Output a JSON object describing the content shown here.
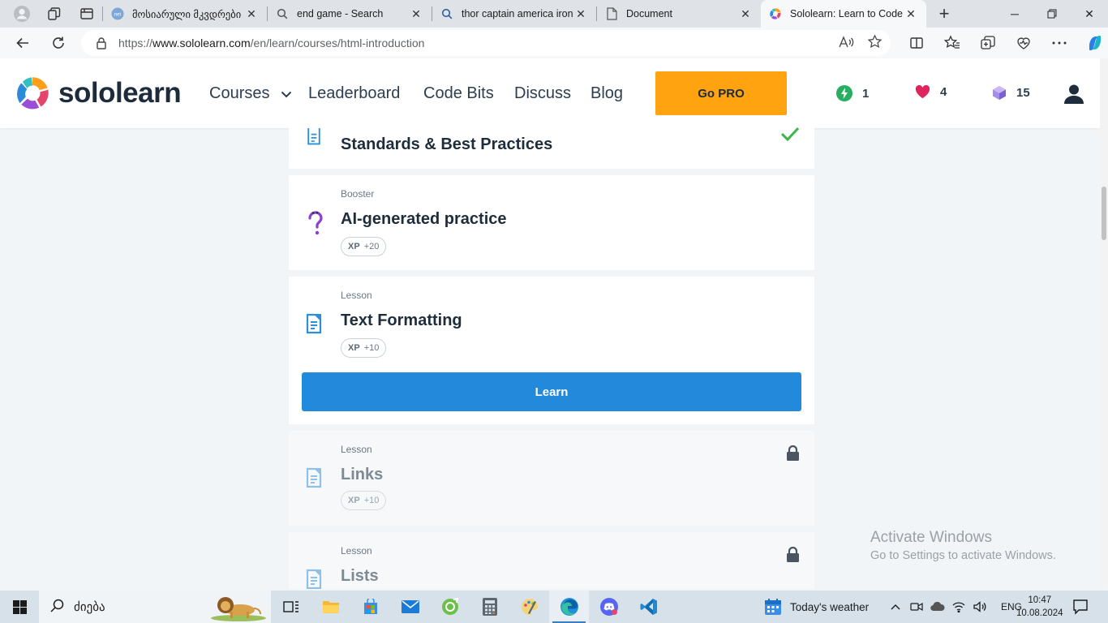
{
  "browser": {
    "tabs": [
      {
        "title": "მოსიარული მკვდრები",
        "active": false
      },
      {
        "title": "end game - Search",
        "active": false
      },
      {
        "title": "thor captain america iron",
        "active": false
      },
      {
        "title": "Document",
        "active": false
      },
      {
        "title": "Sololearn: Learn to Code",
        "active": true
      }
    ],
    "url_prefix": "https://",
    "url_host": "www.sololearn.com",
    "url_path": "/en/learn/courses/html-introduction"
  },
  "site": {
    "logo_text": "sololearn",
    "nav": {
      "courses": "Courses",
      "leaderboard": "Leaderboard",
      "code_bits": "Code Bits",
      "discuss": "Discuss",
      "blog": "Blog"
    },
    "go_pro": "Go PRO",
    "stats": {
      "streak": "1",
      "hearts": "4",
      "bits": "15"
    }
  },
  "lessons": [
    {
      "kind": "",
      "title": "Standards & Best Practices",
      "status": "completed"
    },
    {
      "kind": "Booster",
      "title": "AI-generated practice",
      "xp_label": "XP",
      "xp": "+20",
      "status": "available"
    },
    {
      "kind": "Lesson",
      "title": "Text Formatting",
      "xp_label": "XP",
      "xp": "+10",
      "status": "current",
      "button": "Learn"
    },
    {
      "kind": "Lesson",
      "title": "Links",
      "xp_label": "XP",
      "xp": "+10",
      "status": "locked"
    },
    {
      "kind": "Lesson",
      "title": "Lists",
      "status": "locked"
    }
  ],
  "watermark": {
    "line1": "Activate Windows",
    "line2": "Go to Settings to activate Windows."
  },
  "taskbar": {
    "search_text": "ძიება",
    "weather": "Today's weather",
    "language": "ENG",
    "time": "10:47",
    "date": "10.08.2024"
  },
  "colors": {
    "brand_orange": "#ffa310",
    "learn_blue": "#2389db",
    "heart_red": "#e0245e",
    "streak_green": "#27ae60",
    "bits_purple": "#8b6fd6"
  }
}
